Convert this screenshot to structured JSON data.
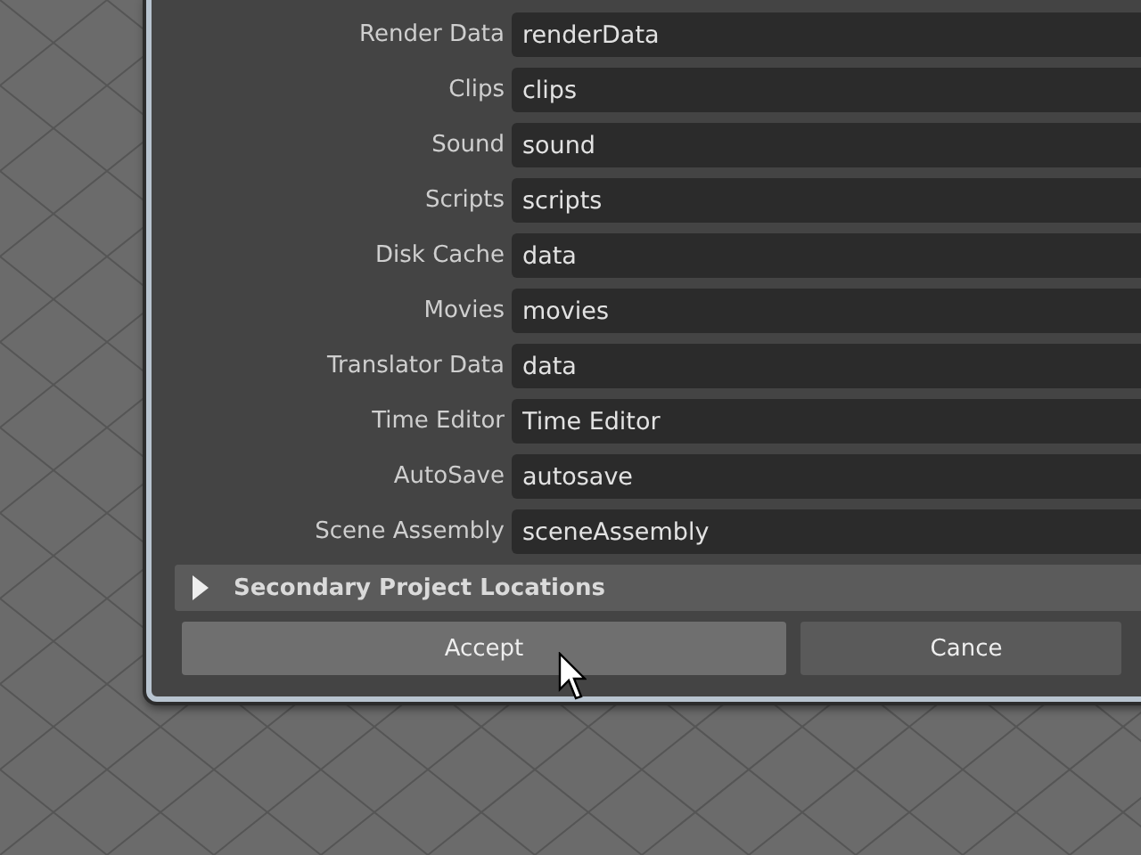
{
  "fields": [
    {
      "label": "Render Data",
      "value": "renderData"
    },
    {
      "label": "Clips",
      "value": "clips"
    },
    {
      "label": "Sound",
      "value": "sound"
    },
    {
      "label": "Scripts",
      "value": "scripts"
    },
    {
      "label": "Disk Cache",
      "value": "data"
    },
    {
      "label": "Movies",
      "value": "movies"
    },
    {
      "label": "Translator Data",
      "value": "data"
    },
    {
      "label": "Time Editor",
      "value": "Time Editor"
    },
    {
      "label": "AutoSave",
      "value": "autosave"
    },
    {
      "label": "Scene Assembly",
      "value": "sceneAssembly"
    }
  ],
  "section": {
    "title": "Secondary Project Locations",
    "expanded": false
  },
  "buttons": [
    "Accept",
    "Cance"
  ]
}
